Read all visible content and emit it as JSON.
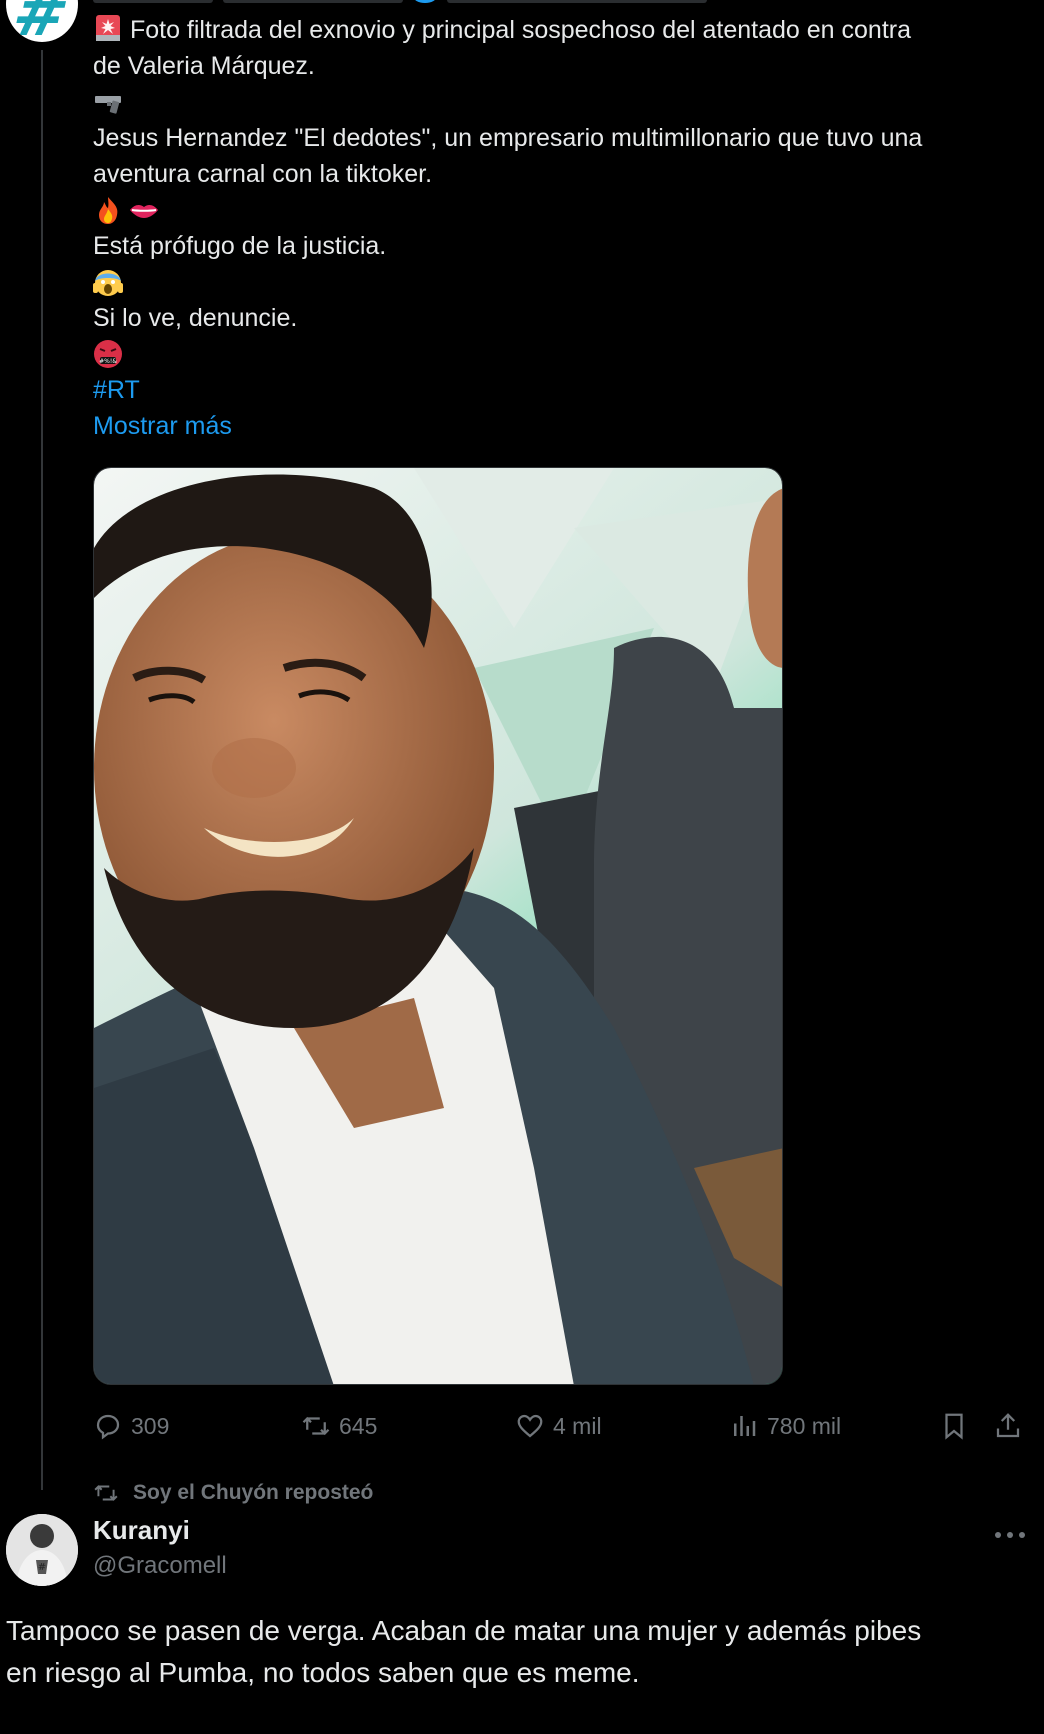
{
  "post": {
    "lines": [
      "Foto filtrada del exnovio y principal sospechoso del atentado en contra",
      "de Valeria Márquez.",
      "Jesus Hernandez \"El dedotes\", un empresario multimillonario que tuvo una",
      "aventura carnal con la tiktoker.",
      "Está prófugo de la justicia.",
      "Si lo ve, denuncie."
    ],
    "hashtag": "#RT",
    "show_more": "Mostrar más",
    "emojis": [
      "siren-icon",
      "pistol-icon",
      "fire-icon",
      "lips-icon",
      "scream-icon",
      "cursing-face-icon"
    ]
  },
  "actions": {
    "replies": "309",
    "reposts": "645",
    "likes": "4 mil",
    "views": "780 mil"
  },
  "repost_note": "Soy el Chuyón reposteó",
  "reply": {
    "name": "Kuranyi",
    "handle": "@Gracomell",
    "text_line1": "Tampoco se pasen de verga. Acaban de matar una mujer y además pibes",
    "text_line2": "en riesgo al Pumba, no todos saben que es meme."
  },
  "colors": {
    "background": "#000000",
    "text": "#e7e9ea",
    "muted": "#71767b",
    "link": "#1d9bf0"
  }
}
